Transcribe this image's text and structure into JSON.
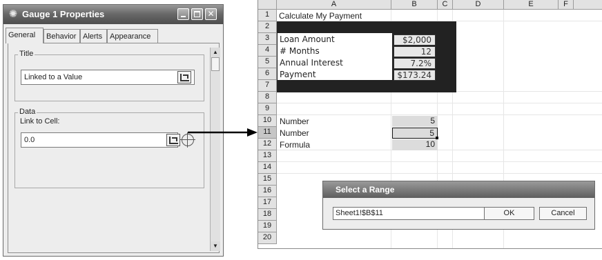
{
  "props_window": {
    "title": "Gauge 1 Properties",
    "icon": "gear-icon",
    "tabs": [
      "General",
      "Behavior",
      "Alerts",
      "Appearance"
    ],
    "active_tab": "General",
    "title_group": {
      "label": "Title",
      "value": "Linked to a Value"
    },
    "data_group": {
      "label": "Data",
      "link_label": "Link to Cell:",
      "value": "0.0"
    }
  },
  "sheet": {
    "columns": [
      "A",
      "B",
      "C",
      "D",
      "E",
      "F"
    ],
    "rows": [
      "1",
      "2",
      "3",
      "4",
      "5",
      "6",
      "7",
      "8",
      "9",
      "10",
      "11",
      "12",
      "13",
      "14",
      "15",
      "16",
      "17",
      "18",
      "19",
      "20"
    ],
    "selected_row": "11",
    "title_cell": "Calculate My Payment",
    "loan_table": [
      {
        "label": "Loan Amount",
        "value": "$2,000"
      },
      {
        "label": "# Months",
        "value": "12"
      },
      {
        "label": "Annual Interest",
        "value": "7.2%"
      },
      {
        "label": "Payment",
        "value": "$173.24"
      }
    ],
    "number_rows": [
      {
        "label": "Number",
        "value": "5"
      },
      {
        "label": "Number",
        "value": "5"
      },
      {
        "label": "Formula",
        "value": "10"
      }
    ]
  },
  "range_dialog": {
    "title": "Select a Range",
    "value": "Sheet1!$B$11",
    "ok_label": "OK",
    "cancel_label": "Cancel"
  }
}
